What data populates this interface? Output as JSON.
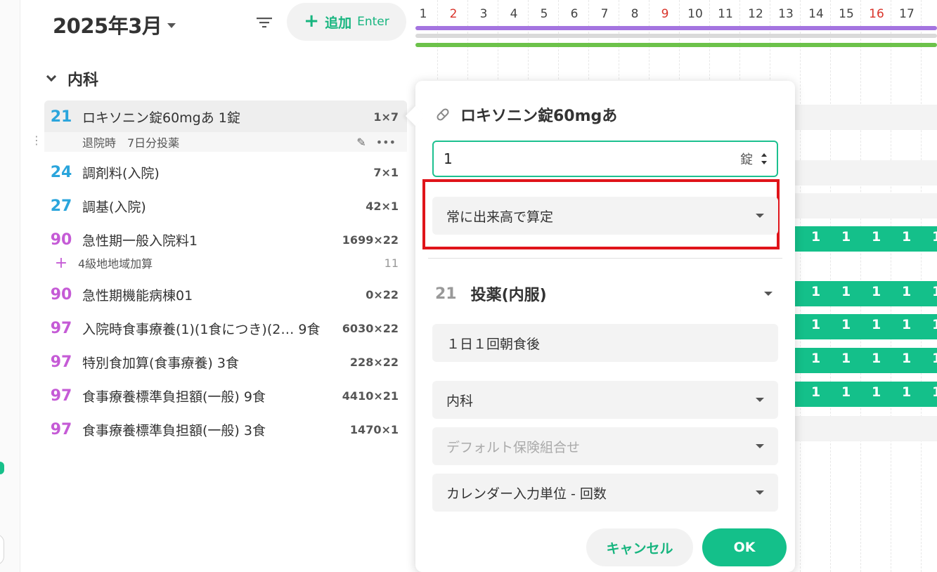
{
  "header": {
    "month_label": "2025年3月",
    "add_button_label": "追加",
    "add_button_shortcut": "Enter"
  },
  "calendar": {
    "days": [
      "1",
      "2",
      "3",
      "4",
      "5",
      "6",
      "7",
      "8",
      "9",
      "10",
      "11",
      "12",
      "13",
      "14",
      "15",
      "16",
      "17"
    ],
    "red_days": [
      "2",
      "9",
      "16"
    ],
    "cell_value": "1"
  },
  "section": {
    "label": "内科"
  },
  "orders": [
    {
      "code": "21",
      "name": "ロキソニン錠60mgあ 1錠",
      "qty": "1×7",
      "sub": "退院時　7日分投薬"
    },
    {
      "code": "24",
      "name": "調剤料(入院)",
      "qty": "7×1"
    },
    {
      "code": "27",
      "name": "調基(入院)",
      "qty": "42×1"
    },
    {
      "code": "90",
      "name": "急性期一般入院料1",
      "qty": "1699×22",
      "addon": "4級地地域加算",
      "addon_count": "11"
    },
    {
      "code": "90",
      "name": "急性期機能病棟01",
      "qty": "0×22"
    },
    {
      "code": "97",
      "name": "入院時食事療養(1)(1食につき)(2… 9食",
      "qty": "6030×22"
    },
    {
      "code": "97",
      "name": "特別食加算(食事療養) 3食",
      "qty": "228×22"
    },
    {
      "code": "97",
      "name": "食事療養標準負担額(一般) 9食",
      "qty": "4410×21"
    },
    {
      "code": "97",
      "name": "食事療養標準負担額(一般) 3食",
      "qty": "1470×1"
    }
  ],
  "popup": {
    "title": "ロキソニン錠60mgあ",
    "quantity_value": "1",
    "quantity_unit": "錠",
    "calc_mode": "常に出来高で算定",
    "group_code": "21",
    "group_name": "投薬(内服)",
    "dosage": "１日１回朝食後",
    "department": "内科",
    "insurance_placeholder": "デフォルト保険組合せ",
    "input_unit": "カレンダー入力単位 - 回数",
    "cancel_label": "キャンセル",
    "ok_label": "OK"
  },
  "colors": {
    "accent": "#14c08a",
    "highlight": "#e0141a",
    "code_blue": "#2aa5dc",
    "code_purple": "#c55bd6",
    "bar_purple": "#a474e0",
    "bar_green": "#6cc24a"
  }
}
